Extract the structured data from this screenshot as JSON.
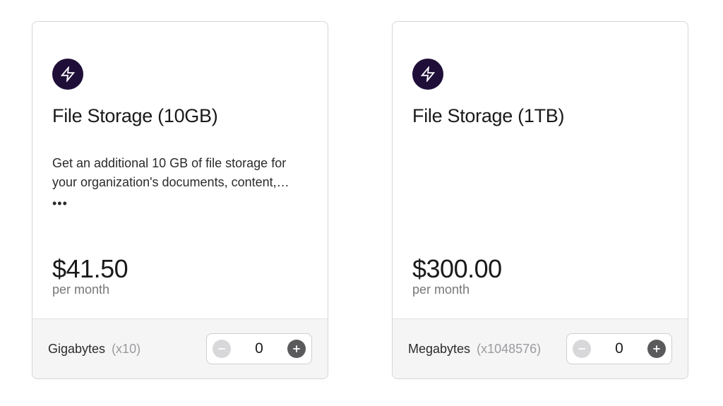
{
  "cards": [
    {
      "title": "File Storage (10GB)",
      "description": "Get an additional 10 GB of file storage for your organization's documents, content,…",
      "more_dots": "•••",
      "price": "$41.50",
      "period": "per month",
      "unit_label": "Gigabytes",
      "unit_multiplier": "(x10)",
      "quantity": "0"
    },
    {
      "title": "File Storage (1TB)",
      "description": "",
      "more_dots": "",
      "price": "$300.00",
      "period": "per month",
      "unit_label": "Megabytes",
      "unit_multiplier": "(x1048576)",
      "quantity": "0"
    }
  ]
}
